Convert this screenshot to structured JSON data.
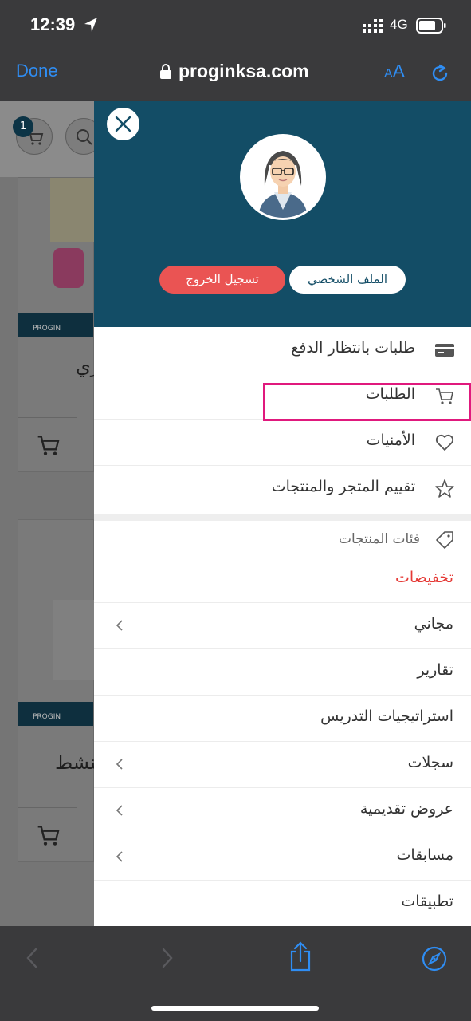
{
  "status_bar": {
    "time": "12:39",
    "network": "4G"
  },
  "address_bar": {
    "done_label": "Done",
    "url": "proginksa.com",
    "aa_small": "A",
    "aa_big": "A"
  },
  "background_page": {
    "cart_count": "1",
    "card1_text": "زي",
    "card2_text": "لنشط",
    "brand": "PROGIN"
  },
  "drawer": {
    "profile_label": "الملف الشخصي",
    "logout_label": "تسجيل الخروج",
    "menu_items": [
      {
        "label": "طلبات بانتظار الدفع",
        "icon": "credit-card-icon"
      },
      {
        "label": "الطلبات",
        "icon": "cart-icon"
      },
      {
        "label": "الأمنيات",
        "icon": "heart-icon"
      },
      {
        "label": "تقييم المتجر والمنتجات",
        "icon": "star-icon"
      }
    ],
    "categories_label": "فئات المنتجات",
    "sale_label": "تخفيضات",
    "sale_color": "#e53935",
    "categories": [
      {
        "label": "مجاني",
        "has_children": true
      },
      {
        "label": "تقارير",
        "has_children": false
      },
      {
        "label": "استراتيجيات التدريس",
        "has_children": false
      },
      {
        "label": "سجلات",
        "has_children": true
      },
      {
        "label": "عروض تقديمية",
        "has_children": true
      },
      {
        "label": "مسابقات",
        "has_children": true
      },
      {
        "label": "تطبيقات",
        "has_children": false
      }
    ]
  },
  "colors": {
    "drawer_header": "#134d66",
    "logout": "#ea5453",
    "highlight": "#e0197d",
    "ios_blue": "#2f8df3"
  }
}
